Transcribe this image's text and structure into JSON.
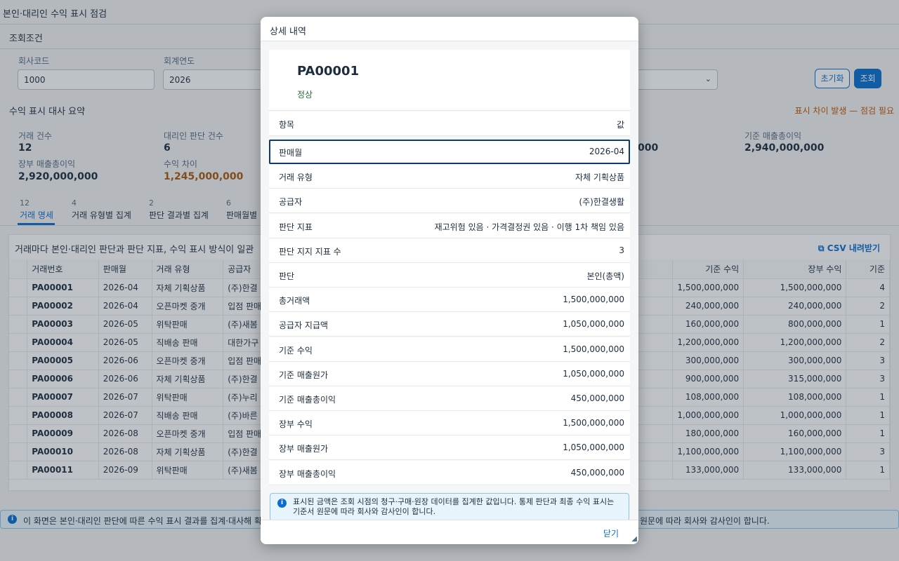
{
  "page": {
    "title": "본인·대리인 수익 표시 점검",
    "filter_title": "조회조건",
    "fields": [
      {
        "label": "회사코드",
        "value": "1000"
      },
      {
        "label": "회계연도",
        "value": "2026"
      }
    ],
    "reset_label": "초기화",
    "search_label": "조회"
  },
  "summary": {
    "title": "수익 표시 대사 요약",
    "warning": "표시 차이 발생 — 점검 필요",
    "kpis": [
      {
        "label": "거래 건수",
        "value": "12"
      },
      {
        "label": "대리인 판단 건수",
        "value": "6"
      },
      {
        "label": "장부 매출총이익",
        "value": "2,920,000,000"
      },
      {
        "label": "수익 차이",
        "value": "1,245,000,000"
      },
      {
        "label": "기준 매출총이익",
        "value": "2,940,000,000"
      },
      {
        "value": "0,000"
      }
    ]
  },
  "tabs": [
    {
      "count": "12",
      "label": "거래 명세"
    },
    {
      "count": "4",
      "label": "거래 유형별 집계"
    },
    {
      "count": "2",
      "label": "판단 결과별 집계"
    },
    {
      "count": "6",
      "label": "판매월별"
    }
  ],
  "table": {
    "description": "거래마다 본인·대리인 판단과 판단 지표, 수익 표시 방식이 일관",
    "csv_label": "CSV 내려받기",
    "columns": [
      "거래번호",
      "판매월",
      "거래 유형",
      "공급자",
      "기준 수익",
      "장부 수익",
      "기준"
    ],
    "rows": [
      [
        "PA00001",
        "2026-04",
        "자체 기획상품",
        "(주)한결",
        "1,500,000,000",
        "1,500,000,000",
        "4"
      ],
      [
        "PA00002",
        "2026-04",
        "오픈마켓 중개",
        "입점 판매",
        "240,000,000",
        "240,000,000",
        "2"
      ],
      [
        "PA00003",
        "2026-05",
        "위탁판매",
        "(주)새봄",
        "160,000,000",
        "800,000,000",
        "1"
      ],
      [
        "PA00004",
        "2026-05",
        "직배송 판매",
        "대한가구",
        "1,200,000,000",
        "1,200,000,000",
        "2"
      ],
      [
        "PA00005",
        "2026-06",
        "오픈마켓 중개",
        "입점 판매",
        "300,000,000",
        "300,000,000",
        "3"
      ],
      [
        "PA00006",
        "2026-06",
        "자체 기획상품",
        "(주)한결",
        "900,000,000",
        "315,000,000",
        "3"
      ],
      [
        "PA00007",
        "2026-07",
        "위탁판매",
        "(주)누리",
        "108,000,000",
        "108,000,000",
        "1"
      ],
      [
        "PA00008",
        "2026-07",
        "직배송 판매",
        "(주)바른",
        "1,000,000,000",
        "1,000,000,000",
        "1"
      ],
      [
        "PA00009",
        "2026-08",
        "오픈마켓 중개",
        "입점 판매",
        "180,000,000",
        "160,000,000",
        "1"
      ],
      [
        "PA00010",
        "2026-08",
        "자체 기획상품",
        "(주)한결",
        "1,100,000,000",
        "1,100,000,000",
        "3"
      ],
      [
        "PA00011",
        "2026-09",
        "위탁판매",
        "(주)새봄",
        "133,000,000",
        "133,000,000",
        "1"
      ]
    ]
  },
  "info_bar": {
    "text_left": "이 화면은 본인·대리인 판단에 따른 수익 표시 결과를 집계·대사해 확",
    "text_right": "원문에 따라 회사와 감사인이 합니다."
  },
  "dialog": {
    "title": "상세 내역",
    "object_title": "PA00001",
    "status": "정상",
    "header_key": "항목",
    "header_value": "값",
    "properties": [
      {
        "key": "판매월",
        "value": "2026-04"
      },
      {
        "key": "거래 유형",
        "value": "자체 기획상품"
      },
      {
        "key": "공급자",
        "value": "(주)한결생활"
      },
      {
        "key": "판단 지표",
        "value": "재고위험 있음 · 가격결정권 있음 · 이행 1차 책임 있음"
      },
      {
        "key": "판단 지지 지표 수",
        "value": "3"
      },
      {
        "key": "판단",
        "value": "본인(총액)"
      },
      {
        "key": "총거래액",
        "value": "1,500,000,000"
      },
      {
        "key": "공급자 지급액",
        "value": "1,050,000,000"
      },
      {
        "key": "기준 수익",
        "value": "1,500,000,000"
      },
      {
        "key": "기준 매출원가",
        "value": "1,050,000,000"
      },
      {
        "key": "기준 매출총이익",
        "value": "450,000,000"
      },
      {
        "key": "장부 수익",
        "value": "1,500,000,000"
      },
      {
        "key": "장부 매출원가",
        "value": "1,050,000,000"
      },
      {
        "key": "장부 매출총이익",
        "value": "450,000,000"
      }
    ],
    "info_text": "표시된 금액은 조회 시점의 청구·구매·원장 데이터를 집계한 값입니다. 통제 판단과 최종 수익 표시는 기준서 원문에 따라 회사와 감사인이 합니다.",
    "close_label": "닫기"
  }
}
